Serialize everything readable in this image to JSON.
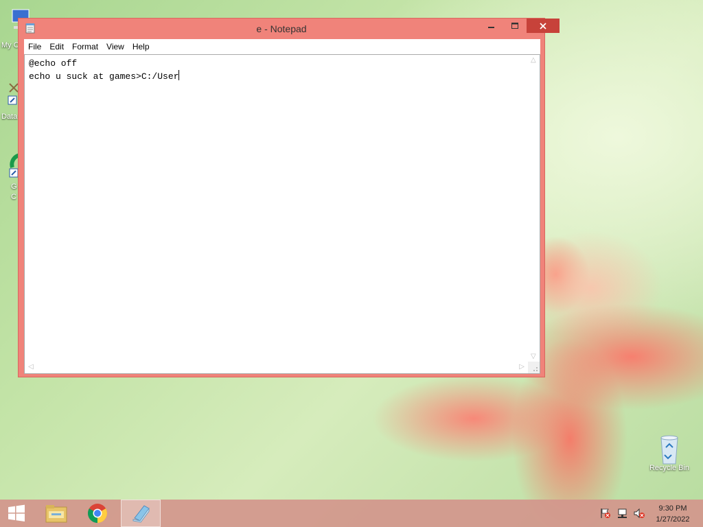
{
  "desktop": {
    "icons": [
      {
        "label": "My C"
      },
      {
        "label": "Data"
      },
      {
        "label": "G"
      },
      {
        "label": "C"
      },
      {
        "label": "Recycle Bin"
      }
    ]
  },
  "window": {
    "title": "e - Notepad",
    "menu": [
      "File",
      "Edit",
      "Format",
      "View",
      "Help"
    ],
    "content_lines": [
      "@echo off",
      "echo u suck at games>C:/User"
    ]
  },
  "taskbar": {
    "pinned": [
      "windows-start",
      "file-explorer",
      "chrome",
      "notepad"
    ],
    "clock": {
      "time": "9:30 PM",
      "date": "1/27/2022"
    }
  },
  "colors": {
    "window_frame": "#f0837a",
    "close_button": "#c7423a",
    "taskbar": "#d2968c"
  }
}
